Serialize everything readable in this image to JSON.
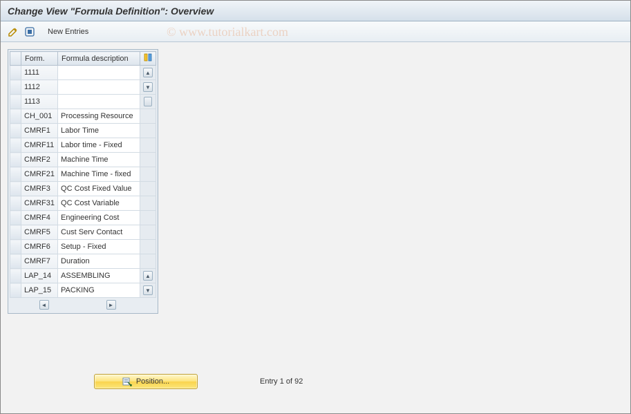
{
  "title": "Change View \"Formula Definition\": Overview",
  "watermark": "© www.tutorialkart.com",
  "toolbar": {
    "new_entries_label": "New Entries"
  },
  "table": {
    "headers": {
      "form": "Form.",
      "description": "Formula description"
    },
    "rows": [
      {
        "form": "1111",
        "description": ""
      },
      {
        "form": "1112",
        "description": ""
      },
      {
        "form": "1113",
        "description": ""
      },
      {
        "form": "CH_001",
        "description": "Processing Resource"
      },
      {
        "form": "CMRF1",
        "description": "Labor Time"
      },
      {
        "form": "CMRF11",
        "description": "Labor time - Fixed"
      },
      {
        "form": "CMRF2",
        "description": "Machine Time"
      },
      {
        "form": "CMRF21",
        "description": "Machine Time - fixed"
      },
      {
        "form": "CMRF3",
        "description": "QC Cost Fixed Value"
      },
      {
        "form": "CMRF31",
        "description": "QC Cost Variable"
      },
      {
        "form": "CMRF4",
        "description": "Engineering Cost"
      },
      {
        "form": "CMRF5",
        "description": "Cust Serv Contact"
      },
      {
        "form": "CMRF6",
        "description": "Setup - Fixed"
      },
      {
        "form": "CMRF7",
        "description": "Duration"
      },
      {
        "form": "LAP_14",
        "description": "ASSEMBLING"
      },
      {
        "form": "LAP_15",
        "description": "PACKING"
      }
    ]
  },
  "footer": {
    "position_label": "Position...",
    "status_text": "Entry 1 of 92"
  }
}
